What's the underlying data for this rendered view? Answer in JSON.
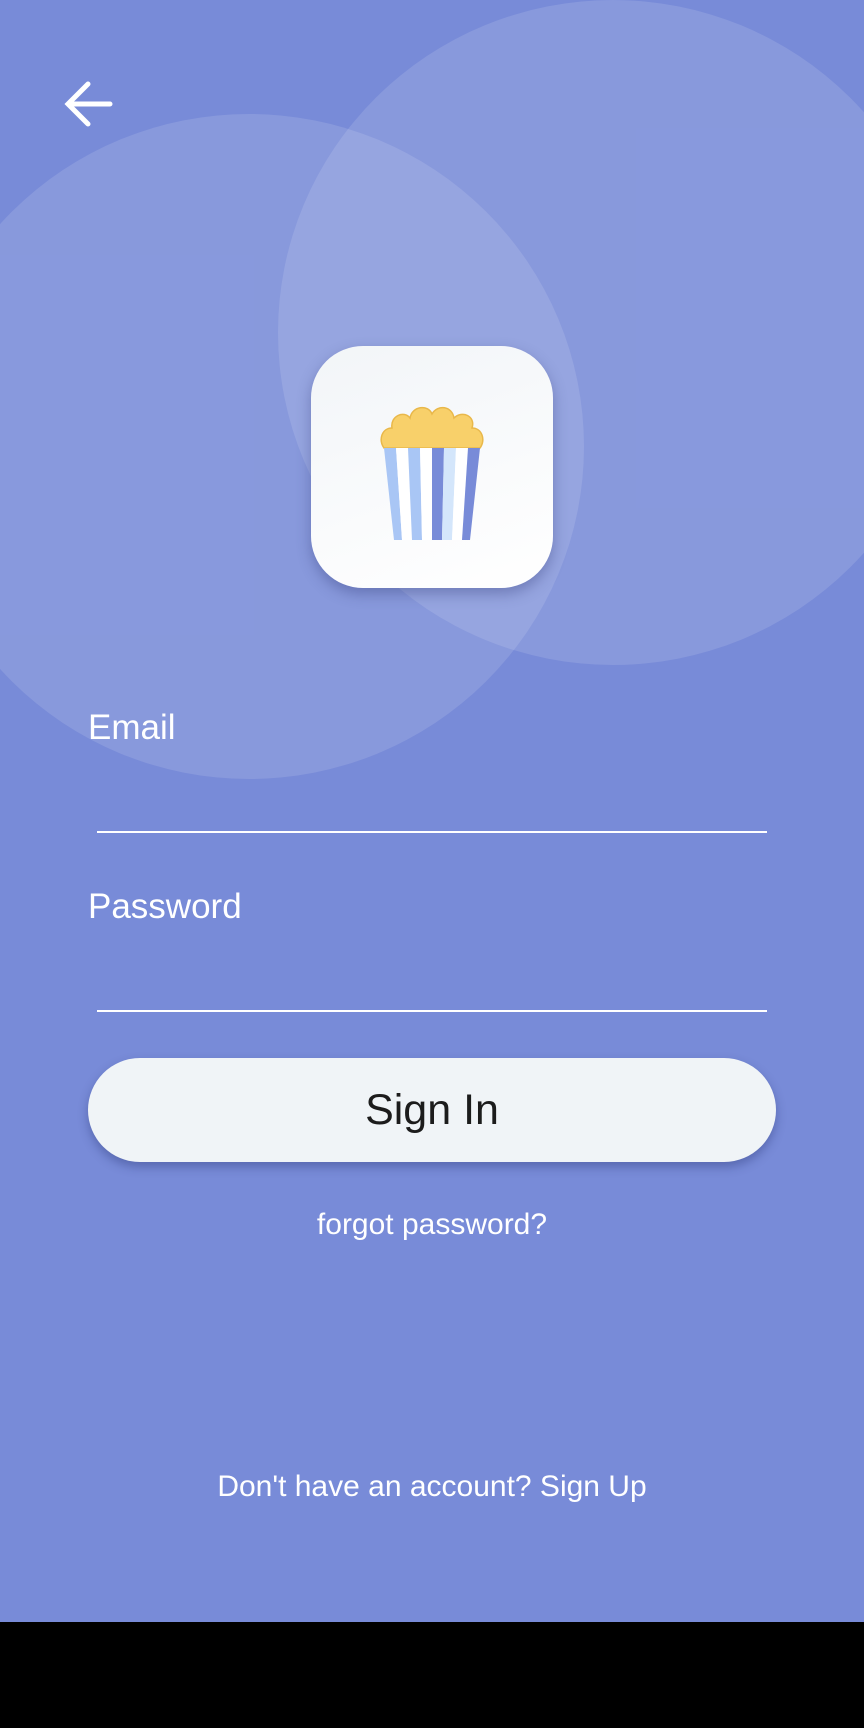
{
  "colors": {
    "background": "#788bd8",
    "text": "#ffffff",
    "button_bg": "#f0f4f7",
    "button_text": "#1c1c1c",
    "popcorn": "#f8d06a",
    "stripe_light": "#a9c6f5",
    "stripe_dark": "#788bd8"
  },
  "header": {
    "back_icon": "arrow-left-icon"
  },
  "logo": {
    "icon": "popcorn-icon"
  },
  "form": {
    "email_label": "Email",
    "email_value": "",
    "password_label": "Password",
    "password_value": "",
    "signin_label": "Sign In",
    "forgot_label": "forgot password?"
  },
  "footer": {
    "signup_prompt": "Don't have an account? Sign Up"
  }
}
